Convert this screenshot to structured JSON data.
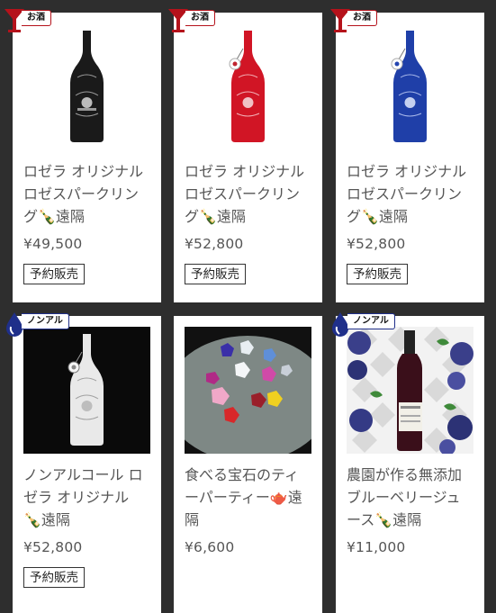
{
  "badges": {
    "alcohol": "お酒",
    "nonalcohol": "ノンアル"
  },
  "products": [
    {
      "title": "ロゼラ オリジナル\nロゼスパークリン\nグ🍾遠隔",
      "price": "¥49,500",
      "tag": "予約販売"
    },
    {
      "title": "ロゼラ オリジナル\nロゼスパークリン\nグ🍾遠隔",
      "price": "¥52,800",
      "tag": "予約販売"
    },
    {
      "title": "ロゼラ オリジナル\nロゼスパークリン\nグ🍾遠隔",
      "price": "¥52,800",
      "tag": "予約販売"
    },
    {
      "title": "ノンアルコール ロ\nゼラ オリジナル\n🍾遠隔",
      "price": "¥52,800",
      "tag": "予約販売"
    },
    {
      "title": "食べる宝石のティ\nーパーティー🫖遠\n隔",
      "price": "¥6,600"
    },
    {
      "title": "農園が作る無添加\nブルーベリージュ\nース🍾遠隔",
      "price": "¥11,000"
    }
  ],
  "colors": {
    "alcohol_badge": "#b5121b",
    "nonalcohol_badge": "#1f2f8a",
    "bottle_black": "#1a1a1a",
    "bottle_red": "#d11525",
    "bottle_blue": "#1f3fa8",
    "bottle_white": "#e9e9e9"
  }
}
